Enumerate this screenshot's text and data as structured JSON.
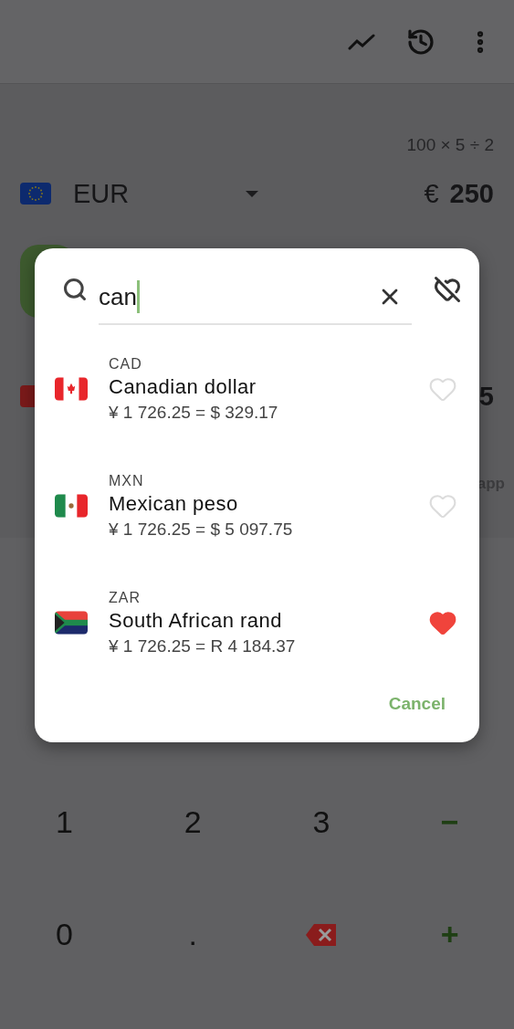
{
  "expression": "100 × 5 ÷ 2",
  "source": {
    "kind": "eu",
    "code": "EUR",
    "symbol": "€",
    "amount": "250"
  },
  "target": {
    "amount": "5"
  },
  "footer_text": "app",
  "dialog": {
    "search": {
      "value": "can"
    },
    "results": [
      {
        "kind": "ca",
        "code": "CAD",
        "name": "Canadian dollar",
        "conversion": "¥ 1 726.25 = $ 329.17",
        "favorite": false
      },
      {
        "kind": "mx",
        "code": "MXN",
        "name": "Mexican peso",
        "conversion": "¥ 1 726.25 = $ 5 097.75",
        "favorite": false
      },
      {
        "kind": "za",
        "code": "ZAR",
        "name": "South African rand",
        "conversion": "¥ 1 726.25 = R 4 184.37",
        "favorite": true
      }
    ],
    "cancel": "Cancel"
  },
  "keypad": [
    {
      "kind": "digit",
      "label": "1"
    },
    {
      "kind": "digit",
      "label": "2"
    },
    {
      "kind": "digit",
      "label": "3"
    },
    {
      "kind": "operator",
      "label": "−"
    },
    {
      "kind": "digit",
      "label": "0"
    },
    {
      "kind": "digit",
      "label": "."
    },
    {
      "kind": "backspace"
    },
    {
      "kind": "operator",
      "label": "+"
    }
  ]
}
